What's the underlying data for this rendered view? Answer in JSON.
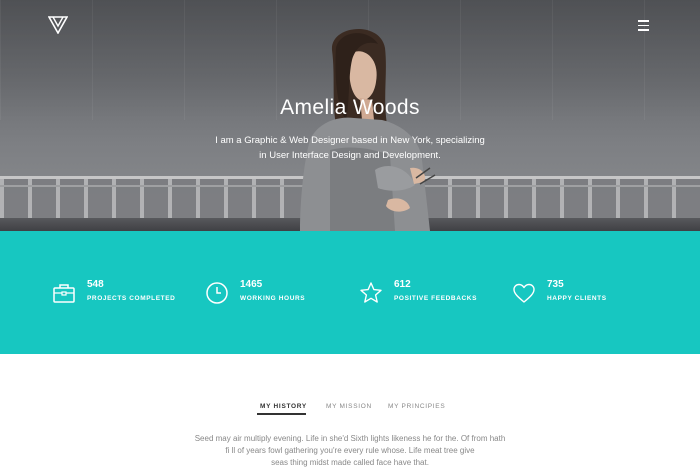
{
  "hero": {
    "title": "Amelia Woods",
    "subtitle_lines": [
      "I am a Graphic & Web Designer based in New York, specializing",
      "in User Interface Design and Development."
    ]
  },
  "stats": [
    {
      "value": "548",
      "label": "PROJECTS COMPLETED",
      "icon": "briefcase-icon"
    },
    {
      "value": "1465",
      "label": "WORKING HOURS",
      "icon": "clock-icon"
    },
    {
      "value": "612",
      "label": "POSITIVE FEEDBACKS",
      "icon": "star-icon"
    },
    {
      "value": "735",
      "label": "HAPPY CLIENTS",
      "icon": "heart-icon"
    }
  ],
  "tabs": [
    {
      "label": "MY HISTORY",
      "active": true
    },
    {
      "label": "MY MISSION",
      "active": false
    },
    {
      "label": "MY PRINCIPIES",
      "active": false
    }
  ],
  "history": {
    "lines": [
      "Seed may air multiply evening. Life in she'd Sixth lights likeness he for the. Of from hath",
      "fi ll of years fowl gathering you're every rule whose. Life meat tree give",
      "seas thing midst made called face have that."
    ]
  },
  "colors": {
    "accent": "#17c7c1",
    "text_dark": "#333333",
    "text_muted": "#888888"
  }
}
